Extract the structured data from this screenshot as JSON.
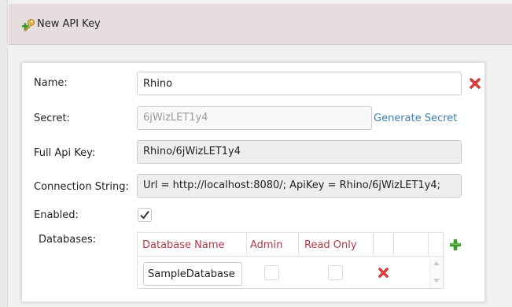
{
  "header": {
    "title": "New API Key",
    "icon": "key-add-icon"
  },
  "form": {
    "name": {
      "label": "Name:",
      "value": "Rhino"
    },
    "secret": {
      "label": "Secret:",
      "value": "6jWizLET1y4",
      "generate_label": "Generate Secret"
    },
    "full_api_key": {
      "label": "Full Api Key:",
      "value": "Rhino/6jWizLET1y4"
    },
    "connection_string": {
      "label": "Connection String:",
      "value": "Url = http://localhost:8080/; ApiKey = Rhino/6jWizLET1y4;"
    },
    "enabled": {
      "label": "Enabled:",
      "checked": true
    },
    "databases": {
      "label": "Databases:",
      "columns": [
        "Database Name",
        "Admin",
        "Read Only"
      ],
      "rows": [
        {
          "database_name": "SampleDatabase",
          "admin": false,
          "read_only": false
        }
      ]
    }
  },
  "colors": {
    "header_bg": "#e6dede",
    "column_header_text": "#b03a48",
    "link": "#3c7fb1",
    "remove_red": "#cc2222",
    "add_green": "#3c9a2a"
  }
}
